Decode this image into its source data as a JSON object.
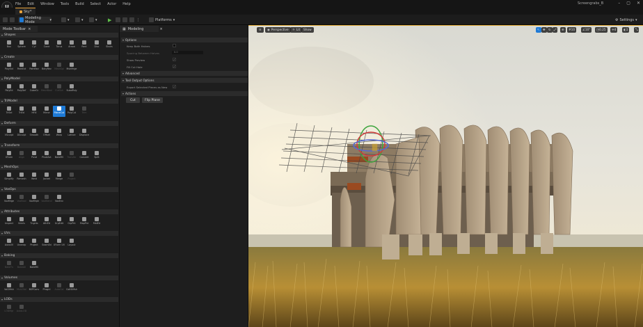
{
  "app": {
    "logo": "U",
    "project_name": "Screengrabs_B",
    "map_tab": "Sky*"
  },
  "menu": [
    "File",
    "Edit",
    "Window",
    "Tools",
    "Build",
    "Select",
    "Actor",
    "Help"
  ],
  "window_controls": [
    "–",
    "▢",
    "✕"
  ],
  "toolbar": {
    "mode": "Modeling Mode",
    "platforms": "Platforms",
    "settings": "Settings"
  },
  "mode_toolbar": {
    "title": "Mode Toolbar",
    "sections": [
      {
        "name": "Shapes",
        "tools": [
          {
            "l": "Box"
          },
          {
            "l": "Sphere"
          },
          {
            "l": "Cyl"
          },
          {
            "l": "Cone"
          },
          {
            "l": "Torus"
          },
          {
            "l": "Arrow"
          },
          {
            "l": "Rect"
          },
          {
            "l": "Disc"
          },
          {
            "l": "Stairs"
          }
        ]
      },
      {
        "name": "Create",
        "tools": [
          {
            "l": "PolyExt"
          },
          {
            "l": "PathExt"
          },
          {
            "l": "PathRev"
          },
          {
            "l": "BdryRev"
          },
          {
            "l": "MeshSpl",
            "dim": true
          },
          {
            "l": "MshMrge"
          }
        ]
      },
      {
        "name": "PolyModel",
        "tools": [
          {
            "l": "PolyEd"
          },
          {
            "l": "PolyDef"
          },
          {
            "l": "CubeGr"
          },
          {
            "l": "MeshBool",
            "dim": true
          },
          {
            "l": "CutOut",
            "dim": true
          },
          {
            "l": "SubdPoly"
          }
        ]
      },
      {
        "name": "TriModel",
        "tools": [
          {
            "l": "TriSel"
          },
          {
            "l": "TriEd"
          },
          {
            "l": "HFill"
          },
          {
            "l": "Mirror"
          },
          {
            "l": "PlaneCut",
            "active": true
          },
          {
            "l": "PolyCut"
          },
          {
            "l": "Trim",
            "dim": true
          }
        ]
      },
      {
        "name": "Deform",
        "tools": [
          {
            "l": "VSculpt"
          },
          {
            "l": "DSculpt"
          },
          {
            "l": "Smooth"
          },
          {
            "l": "Offset"
          },
          {
            "l": "Warp"
          },
          {
            "l": "Lattice"
          },
          {
            "l": "Displace"
          }
        ]
      },
      {
        "name": "Transform",
        "tools": [
          {
            "l": "XForm"
          },
          {
            "l": "Align",
            "dim": true
          },
          {
            "l": "Pivot"
          },
          {
            "l": "PivotAct"
          },
          {
            "l": "BakeRS"
          },
          {
            "l": "Transfer",
            "dim": true
          },
          {
            "l": "Convert"
          },
          {
            "l": "Split"
          }
        ]
      },
      {
        "name": "MeshOps",
        "tools": [
          {
            "l": "Simplify"
          },
          {
            "l": "Remesh"
          },
          {
            "l": "Weld"
          },
          {
            "l": "Jacket"
          },
          {
            "l": "Merge"
          },
          {
            "l": "Project",
            "dim": true
          }
        ]
      },
      {
        "name": "VoxOps",
        "tools": [
          {
            "l": "VoxMrge"
          },
          {
            "l": "VoxBool",
            "dim": true
          },
          {
            "l": "VoxMrph"
          },
          {
            "l": "VoxBlend",
            "dim": true
          },
          {
            "l": "VoxEnv"
          }
        ]
      },
      {
        "name": "Attributes",
        "tools": [
          {
            "l": "Inspect"
          },
          {
            "l": "Nrmls"
          },
          {
            "l": "Tngnts"
          },
          {
            "l": "AttrEd"
          },
          {
            "l": "GrpEdit"
          },
          {
            "l": "GrpPnt"
          },
          {
            "l": "MapPnt"
          },
          {
            "l": "MatEd"
          }
        ]
      },
      {
        "name": "UVs",
        "tools": [
          {
            "l": "AutoUV"
          },
          {
            "l": "Unwrap"
          },
          {
            "l": "Project"
          },
          {
            "l": "SeamEd"
          },
          {
            "l": "XForm UV"
          },
          {
            "l": "Layout"
          }
        ]
      },
      {
        "name": "Baking",
        "tools": [
          {
            "l": "BakeTx",
            "dim": true
          },
          {
            "l": "BakeAll",
            "dim": true
          },
          {
            "l": "BakeRS"
          }
        ]
      },
      {
        "name": "Volumes",
        "tools": [
          {
            "l": "Vol2Msh"
          },
          {
            "l": "Msh2Vol",
            "dim": true
          },
          {
            "l": "BSPConv"
          },
          {
            "l": "PhsgnI"
          },
          {
            "l": "AutoCol",
            "dim": true
          },
          {
            "l": "CollSlMsh"
          }
        ]
      },
      {
        "name": "LODs",
        "tools": [
          {
            "l": "LODMgr",
            "dim": true
          },
          {
            "l": "AutoLOD",
            "dim": true
          }
        ]
      }
    ]
  },
  "modeling_panel": {
    "title": "Modeling",
    "options_header": "Options",
    "props": [
      {
        "label": "Keep Both Halves",
        "type": "check",
        "on": false
      },
      {
        "label": "Spacing Between Halves",
        "type": "num",
        "value": "0.0",
        "dim": true
      },
      {
        "label": "Show Preview",
        "type": "check",
        "on": true
      },
      {
        "label": "Fill Cut Hole",
        "type": "check",
        "on": true
      }
    ],
    "advanced_header": "Advanced",
    "tool_output_header": "Tool Output Options",
    "tool_output_prop": "Export Selected Pieces as New",
    "actions_header": "Actions",
    "cut_button": "Cut",
    "flip_button": "Flip Plane"
  },
  "viewport": {
    "perspective_label": "Perspective",
    "lit_label": "Lit",
    "show_label": "Show",
    "snap_values": [
      "10",
      "10°",
      "0.25"
    ],
    "speed_label": "4",
    "fov_label": "1"
  },
  "colors": {
    "accent_blue": "#1e7ad6",
    "map_tab_orange": "#e8a33c",
    "play_green": "#5fbf4a"
  }
}
